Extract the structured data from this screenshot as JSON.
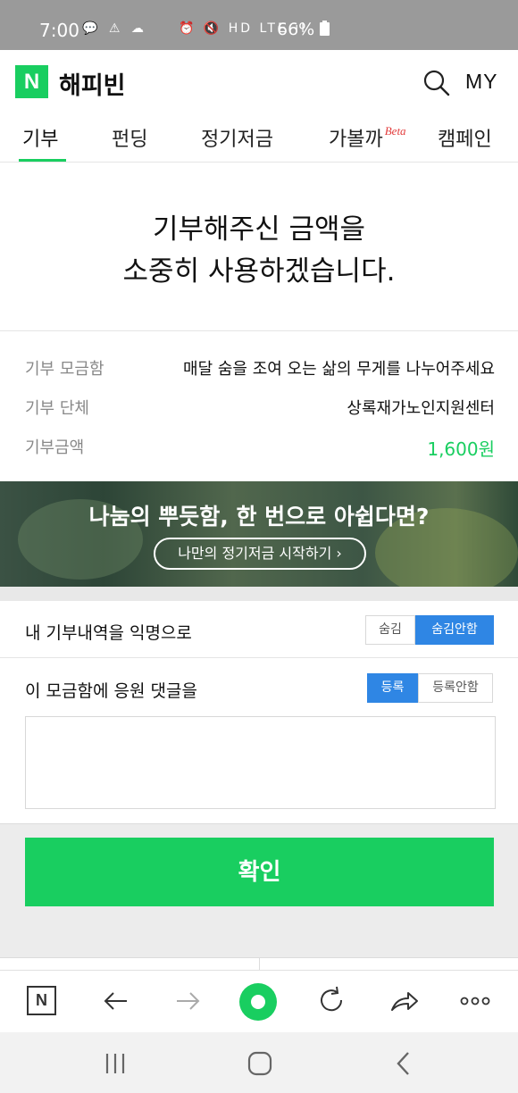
{
  "status_bar": {
    "time": "7:00",
    "left_icons": "💬 ⚠ ☁",
    "right_icons": "⏰ 🔇 HD LTE ıl",
    "battery": "66%"
  },
  "app": {
    "logo_letter": "N",
    "name": "해피빈",
    "my_label": "MY",
    "accent": "#19ce60"
  },
  "tabs": [
    {
      "label": "기부",
      "active": true
    },
    {
      "label": "펀딩",
      "active": false
    },
    {
      "label": "정기저금",
      "active": false
    },
    {
      "label": "가볼까",
      "badge": "Beta",
      "active": false
    },
    {
      "label": "캠페인",
      "active": false
    }
  ],
  "thanks": {
    "line1": "기부해주신 금액을",
    "line2": "소중히 사용하겠습니다."
  },
  "donation_info": [
    {
      "key": "기부 모금함",
      "value": "매달 숨을 조여 오는 삶의 무게를 나누어주세요"
    },
    {
      "key": "기부 단체",
      "value": "상록재가노인지원센터"
    },
    {
      "key": "기부금액",
      "value": "1,600원"
    }
  ],
  "banner": {
    "headline": "나눔의 뿌듯함, 한 번으로 아쉽다면?",
    "cta": "나만의 정기저금 시작하기 ›"
  },
  "anonymous_option": {
    "label": "내 기부내역을 익명으로",
    "options": [
      "숨김",
      "숨김안함"
    ],
    "selected": "숨김안함"
  },
  "comment_option": {
    "label": "이 모금함에 응원 댓글을",
    "options": [
      "등록",
      "등록안함"
    ],
    "selected": "등록",
    "placeholder": ""
  },
  "confirm_label": "확인",
  "segment_active_color": "#2f86e4"
}
